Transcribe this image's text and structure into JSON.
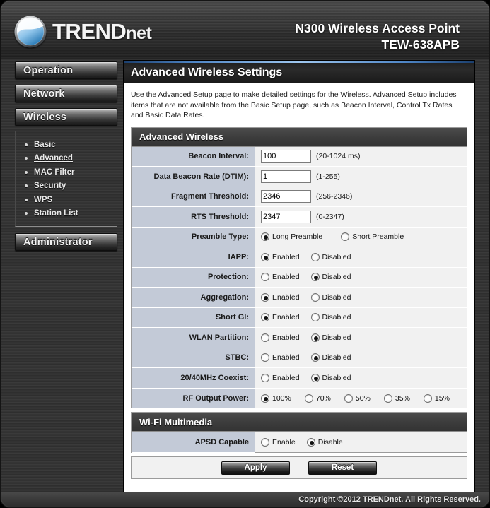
{
  "banner": {
    "logo_text_trend": "TREND",
    "logo_text_net": "net",
    "logo_icon": "trendnet-swoosh-logo",
    "product_name": "N300 Wireless Access Point",
    "model": "TEW-638APB"
  },
  "sidebar": {
    "items": [
      {
        "label": "Operation"
      },
      {
        "label": "Network"
      },
      {
        "label": "Wireless"
      },
      {
        "label": "Administrator"
      }
    ],
    "submenu": [
      {
        "label": "Basic",
        "active": false
      },
      {
        "label": "Advanced",
        "active": true
      },
      {
        "label": "MAC Filter",
        "active": false
      },
      {
        "label": "Security",
        "active": false
      },
      {
        "label": "WPS",
        "active": false
      },
      {
        "label": "Station List",
        "active": false
      }
    ]
  },
  "page": {
    "title": "Advanced Wireless Settings",
    "description": "Use the Advanced Setup page to make detailed settings for the Wireless. Advanced Setup includes items that are not available from the Basic Setup page, such as Beacon Interval, Control Tx Rates and Basic Data Rates."
  },
  "advanced_wireless": {
    "section_title": "Advanced Wireless",
    "beacon_interval": {
      "label": "Beacon Interval:",
      "value": "100",
      "hint": "(20-1024 ms)"
    },
    "dtim": {
      "label": "Data Beacon Rate (DTIM):",
      "value": "1",
      "hint": "(1-255)"
    },
    "fragment_threshold": {
      "label": "Fragment Threshold:",
      "value": "2346",
      "hint": "(256-2346)"
    },
    "rts_threshold": {
      "label": "RTS Threshold:",
      "value": "2347",
      "hint": "(0-2347)"
    },
    "preamble_type": {
      "label": "Preamble Type:",
      "options": [
        {
          "label": "Long Preamble",
          "selected": true
        },
        {
          "label": "Short Preamble",
          "selected": false
        }
      ]
    },
    "iapp": {
      "label": "IAPP:",
      "options": [
        {
          "label": "Enabled",
          "selected": true
        },
        {
          "label": "Disabled",
          "selected": false
        }
      ]
    },
    "protection": {
      "label": "Protection:",
      "options": [
        {
          "label": "Enabled",
          "selected": false
        },
        {
          "label": "Disabled",
          "selected": true
        }
      ]
    },
    "aggregation": {
      "label": "Aggregation:",
      "options": [
        {
          "label": "Enabled",
          "selected": true
        },
        {
          "label": "Disabled",
          "selected": false
        }
      ]
    },
    "short_gi": {
      "label": "Short GI:",
      "options": [
        {
          "label": "Enabled",
          "selected": true
        },
        {
          "label": "Disabled",
          "selected": false
        }
      ]
    },
    "wlan_partition": {
      "label": "WLAN Partition:",
      "options": [
        {
          "label": "Enabled",
          "selected": false
        },
        {
          "label": "Disabled",
          "selected": true
        }
      ]
    },
    "stbc": {
      "label": "STBC:",
      "options": [
        {
          "label": "Enabled",
          "selected": false
        },
        {
          "label": "Disabled",
          "selected": true
        }
      ]
    },
    "coexist": {
      "label": "20/40MHz Coexist:",
      "options": [
        {
          "label": "Enabled",
          "selected": false
        },
        {
          "label": "Disabled",
          "selected": true
        }
      ]
    },
    "rf_output_power": {
      "label": "RF Output Power:",
      "options": [
        {
          "label": "100%",
          "selected": true
        },
        {
          "label": "70%",
          "selected": false
        },
        {
          "label": "50%",
          "selected": false
        },
        {
          "label": "35%",
          "selected": false
        },
        {
          "label": "15%",
          "selected": false
        }
      ]
    }
  },
  "wifi_multimedia": {
    "section_title": "Wi-Fi Multimedia",
    "apsd": {
      "label": "APSD Capable",
      "options": [
        {
          "label": "Enable",
          "selected": false
        },
        {
          "label": "Disable",
          "selected": true
        }
      ]
    }
  },
  "actions": {
    "apply_label": "Apply",
    "reset_label": "Reset"
  },
  "footer": {
    "copyright": "Copyright ©2012 TRENDnet. All Rights Reserved."
  },
  "colors": {
    "accent_blue": "#9ec6ee",
    "label_cell": "#c3cad7",
    "row_bg": "#f1f1f1",
    "panel_head": "#3d3d3d",
    "frame": "#343434"
  }
}
